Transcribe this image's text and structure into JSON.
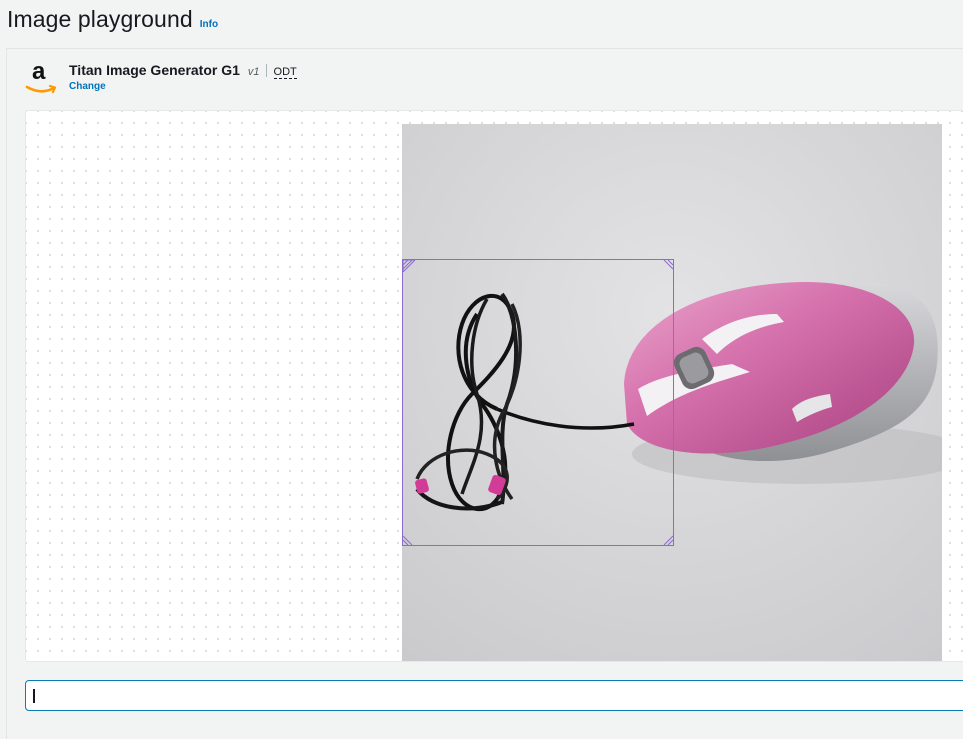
{
  "header": {
    "title": "Image playground",
    "info_label": "Info"
  },
  "model": {
    "provider_icon": "amazon-logo",
    "name": "Titan Image Generator G1",
    "version": "v1",
    "mode": "ODT",
    "change_label": "Change"
  },
  "canvas": {
    "image_subject": "pink-computer-mouse",
    "mask_color": "#8d6ad0"
  },
  "prompt": {
    "value": "",
    "placeholder": ""
  },
  "colors": {
    "link": "#0073bb",
    "focus_border": "#0a7bb8"
  }
}
